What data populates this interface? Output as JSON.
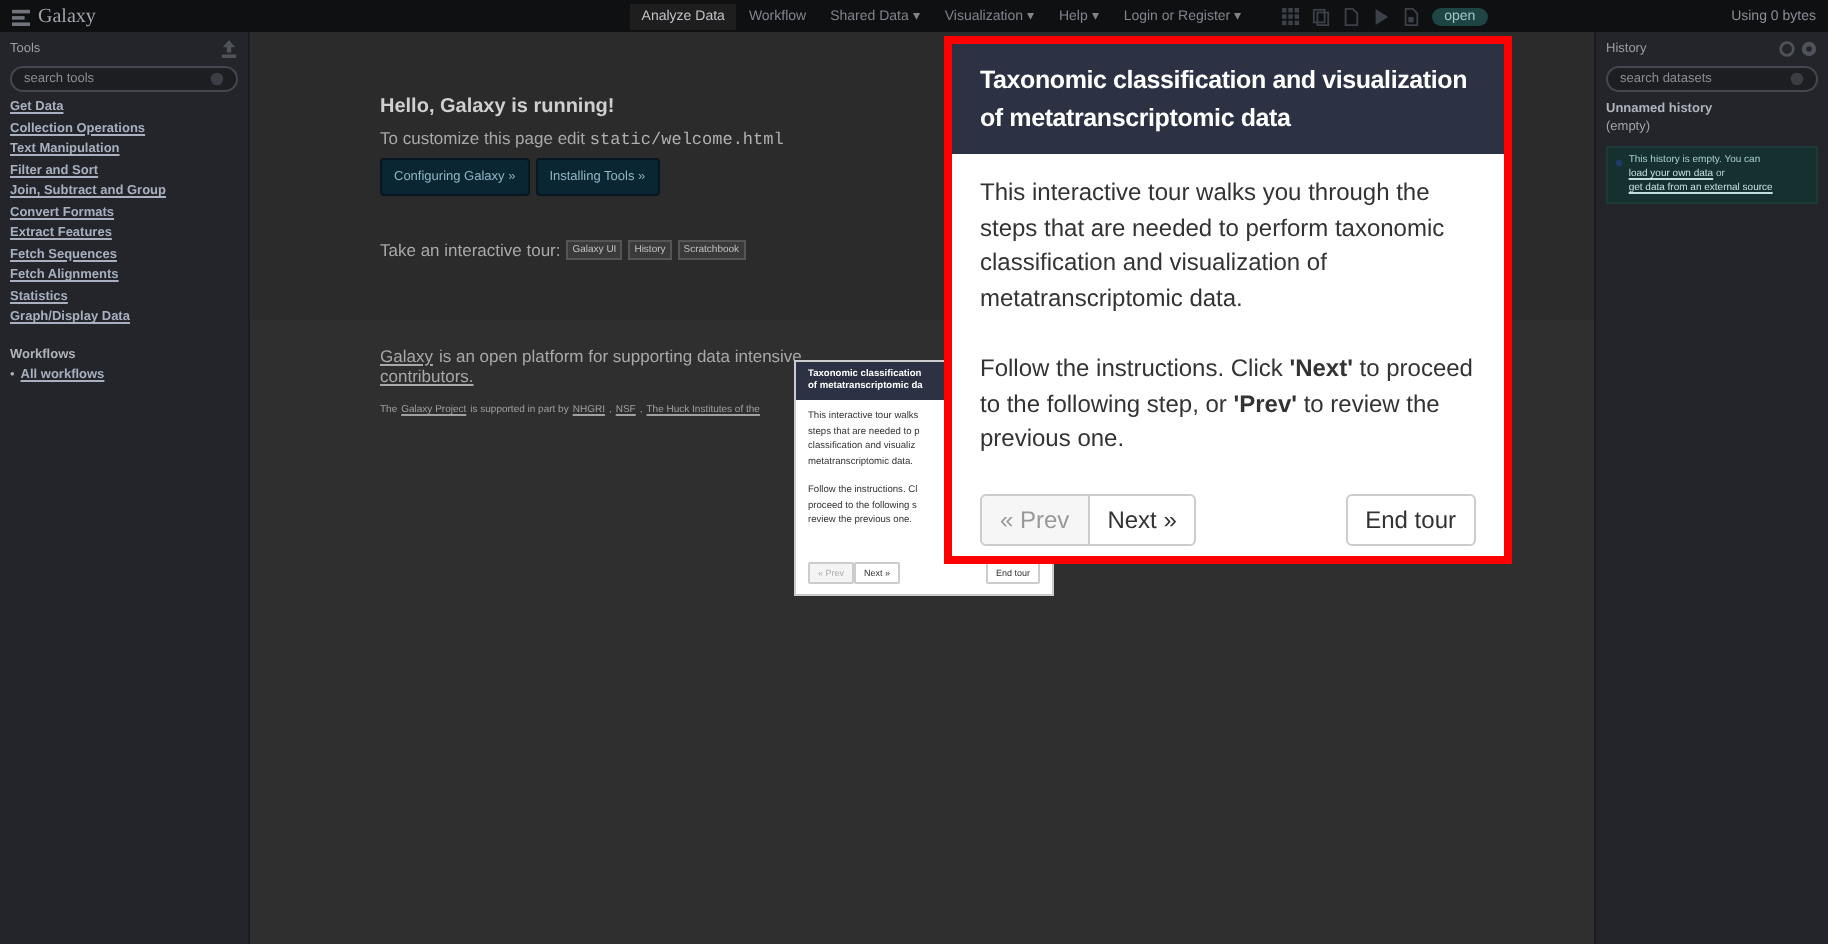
{
  "navbar": {
    "brand": "Galaxy",
    "items": [
      {
        "label": "Analyze Data",
        "selected": true
      },
      {
        "label": "Workflow",
        "selected": false
      },
      {
        "label": "Shared Data ▾",
        "selected": false
      },
      {
        "label": "Visualization ▾",
        "selected": false
      },
      {
        "label": "Help ▾",
        "selected": false
      },
      {
        "label": "Login or Register ▾",
        "selected": false
      }
    ],
    "pill": "open",
    "usage": "Using 0 bytes"
  },
  "tool_panel": {
    "title": "Tools",
    "search": {
      "placeholder": "search tools"
    },
    "sections": [
      "Get Data",
      "Collection Operations",
      "Text Manipulation",
      "Filter and Sort",
      "Join, Subtract and Group",
      "Convert Formats",
      "Extract Features",
      "Fetch Sequences",
      "Fetch Alignments",
      "Statistics",
      "Graph/Display Data"
    ],
    "workflows_title": "Workflows",
    "workflows": [
      {
        "bullet": "•",
        "label": "All workflows"
      }
    ]
  },
  "welcome": {
    "heading": "Hello, Galaxy is running!",
    "customize": "To customize this page edit",
    "path": "static/welcome.html",
    "buttons": [
      "Configuring Galaxy »",
      "Installing Tools »"
    ],
    "tour_label": "Take an interactive tour:",
    "tours": [
      "Galaxy UI",
      "History",
      "Scratchbook"
    ],
    "about": "is an open platform for supporting data intensive",
    "about_link": "Galaxy",
    "contributors": "contributors.",
    "support_lines": [
      {
        "text": "The",
        "link": false
      },
      {
        "text": "Galaxy Project",
        "link": true
      },
      {
        "text": "is supported in part by",
        "link": false
      },
      {
        "text": "NHGRI",
        "link": true
      },
      {
        "text": ",",
        "link": false
      },
      {
        "text": "NSF",
        "link": true
      },
      {
        "text": ",",
        "link": false
      },
      {
        "text": "The Huck Institutes of the",
        "link": true
      }
    ]
  },
  "history_panel": {
    "title": "History",
    "search": {
      "placeholder": "search datasets"
    },
    "name": "Unnamed history",
    "status": "(empty)",
    "message": "This history is empty. You can",
    "link1": "load your own data",
    "middle": "or",
    "link2": "get data from an external source"
  },
  "tour_step": {
    "title_lines": [
      "Taxonomic classification",
      "of metatranscriptomic da"
    ],
    "body_lines": [
      "This interactive tour walks",
      "steps that are needed to p",
      "classification and visualiz",
      "metatranscriptomic data."
    ],
    "follow_lines": [
      "Follow the instructions. Cl",
      "proceed to the following s",
      "review the previous one."
    ],
    "prev": {
      "label": "« Prev",
      "disabled": true
    },
    "next": {
      "label": "Next »",
      "disabled": false
    },
    "end": "End tour"
  },
  "tour_step_zoomed": {
    "title": "Taxonomic classification and visualization of metatranscriptomic data",
    "body": "This interactive tour walks you through the steps that are needed to perform taxonomic classification and visualization of metatranscriptomic data.",
    "follow": "Follow the instructions. Click **'Next'** to proceed to the following step, or **'Prev'** to review the previous one.",
    "prev": {
      "label": "« Prev",
      "disabled": true
    },
    "next": {
      "label": "Next »",
      "disabled": false
    },
    "end": "End tour"
  }
}
